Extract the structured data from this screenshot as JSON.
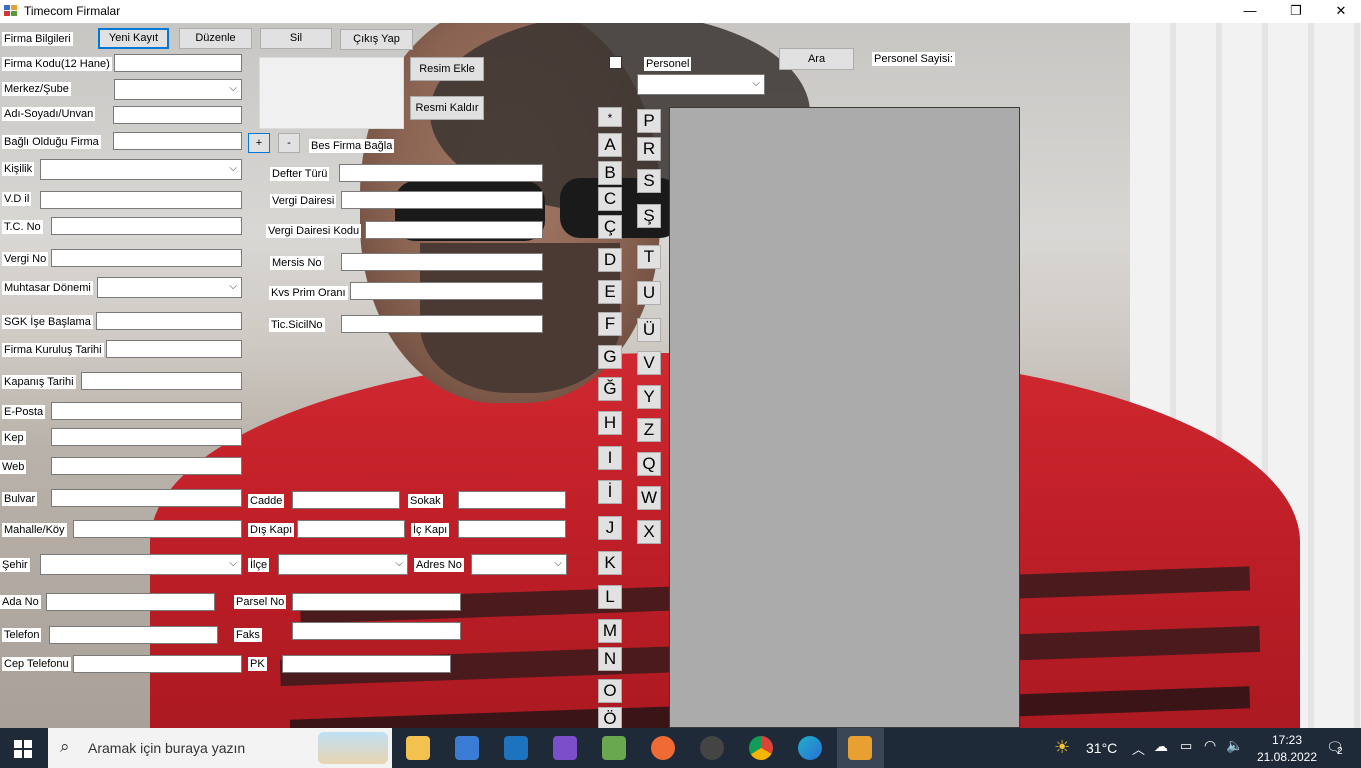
{
  "window": {
    "title": "Timecom Firmalar",
    "min": "—",
    "max": "❐",
    "close": "✕"
  },
  "toolbar": {
    "section_label": "Firma Bilgileri",
    "new": "Yeni Kayıt",
    "edit": "Düzenle",
    "delete": "Sil",
    "exit": "Çıkış Yap"
  },
  "form": {
    "firma_kodu": "Firma Kodu(12 Hane)",
    "merkez_sube": "Merkez/Şube",
    "adi_soyadi": "Adı-Soyadı/Unvan",
    "bagli_firma": "Bağlı Olduğu Firma",
    "kisilik": "Kişilik",
    "vd_il": "V.D il",
    "tc_no": "T.C. No",
    "vergi_no": "Vergi No",
    "muhtasar": "Muhtasar Dönemi",
    "sgk": "SGK İşe Başlama",
    "kurulus": "Firma Kuruluş Tarihi",
    "kapanis": "Kapanış Tarihi",
    "eposta": "E-Posta",
    "kep": "Kep",
    "web": "Web",
    "bulvar": "Bulvar",
    "cadde": "Cadde",
    "sokak": "Sokak",
    "mahalle": "Mahalle/Köy",
    "dis_kapi": "Dış Kapı",
    "ic_kapi": "İç Kapı",
    "sehir": "Şehir",
    "ilce": "İlçe",
    "adres_no": "Adres No",
    "ada_no": "Ada No",
    "parsel_no": "Parsel No",
    "telefon": "Telefon",
    "faks": "Faks",
    "cep": "Cep Telefonu",
    "pk": "PK",
    "defter": "Defter Türü",
    "vergi_dairesi": "Vergi Dairesi",
    "vergi_dairesi_kodu": "Vergi Dairesi Kodu",
    "mersis": "Mersis No",
    "kvs": "Kvs Prim Oranı",
    "ticsicil": "Tic.SicilNo",
    "resim_ekle": "Resim Ekle",
    "resim_kaldir": "Resmi Kaldır",
    "plus": "+",
    "minus": "-",
    "bes": "Bes Firma Bağla"
  },
  "search": {
    "personel": "Personel",
    "ara": "Ara",
    "personel_sayisi": "Personel Sayisi:"
  },
  "letters_left": [
    "*",
    "A",
    "B",
    "C",
    "Ç",
    "D",
    "E",
    "F",
    "G",
    "Ğ",
    "H",
    "I",
    "İ",
    "J",
    "K",
    "L",
    "M",
    "N",
    "O",
    "Ö"
  ],
  "letters_right": [
    "P",
    "R",
    "S",
    "Ş",
    "T",
    "U",
    "Ü",
    "V",
    "Y",
    "Z",
    "Q",
    "W",
    "X"
  ],
  "taskbar": {
    "search_placeholder": "Aramak için buraya yazın",
    "temperature": "31°C",
    "time": "17:23",
    "date": "21.08.2022",
    "notifications": "2",
    "apps": [
      "file-explorer-icon",
      "store-icon",
      "mail-icon",
      "visual-studio-icon",
      "sql-tool-icon",
      "postman-icon",
      "github-icon",
      "chrome-icon",
      "edge-icon",
      "timecom-app-icon"
    ],
    "colors": {
      "bar": "#1f2a38",
      "accent": "#0078d7"
    }
  }
}
